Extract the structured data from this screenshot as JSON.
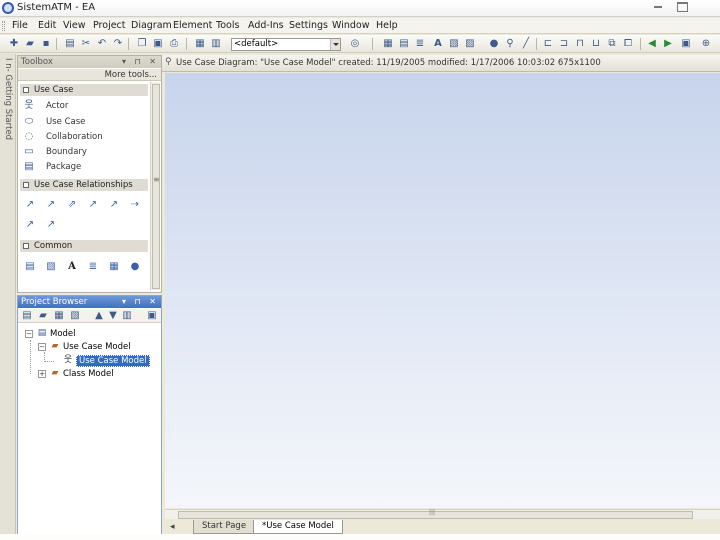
{
  "window": {
    "title": "SistemATM - EA"
  },
  "menu": [
    "File",
    "Edit",
    "View",
    "Project",
    "Diagram",
    "Element",
    "Tools",
    "Add-Ins",
    "Settings",
    "Window",
    "Help"
  ],
  "toolbar": {
    "workspace_combo": "<default>"
  },
  "side_strip": {
    "label": "I n- Getting Started"
  },
  "toolbox": {
    "title": "Toolbox",
    "more_tools": "More tools...",
    "sections": {
      "use_case": {
        "title": "Use Case",
        "items": [
          "Actor",
          "Use Case",
          "Collaboration",
          "Boundary",
          "Package"
        ]
      },
      "relationships": {
        "title": "Use Case Relationships"
      },
      "common": {
        "title": "Common"
      }
    }
  },
  "project_browser": {
    "title": "Project Browser",
    "tree": {
      "root": "Model",
      "child1": "Use Case Model",
      "child1_1": "Use Case Model",
      "child2": "Class Model"
    }
  },
  "diagram": {
    "header": "Use Case Diagram: \"Use Case Model\"   created: 11/19/2005  modified: 1/17/2006 10:03:02  675x1100"
  },
  "tabs": [
    "Start Page",
    "*Use Case Model"
  ],
  "colors": {
    "selection": "#316ac5",
    "canvas_top": "#c7d4ec",
    "panel_header_active": "#3f6fc0"
  }
}
